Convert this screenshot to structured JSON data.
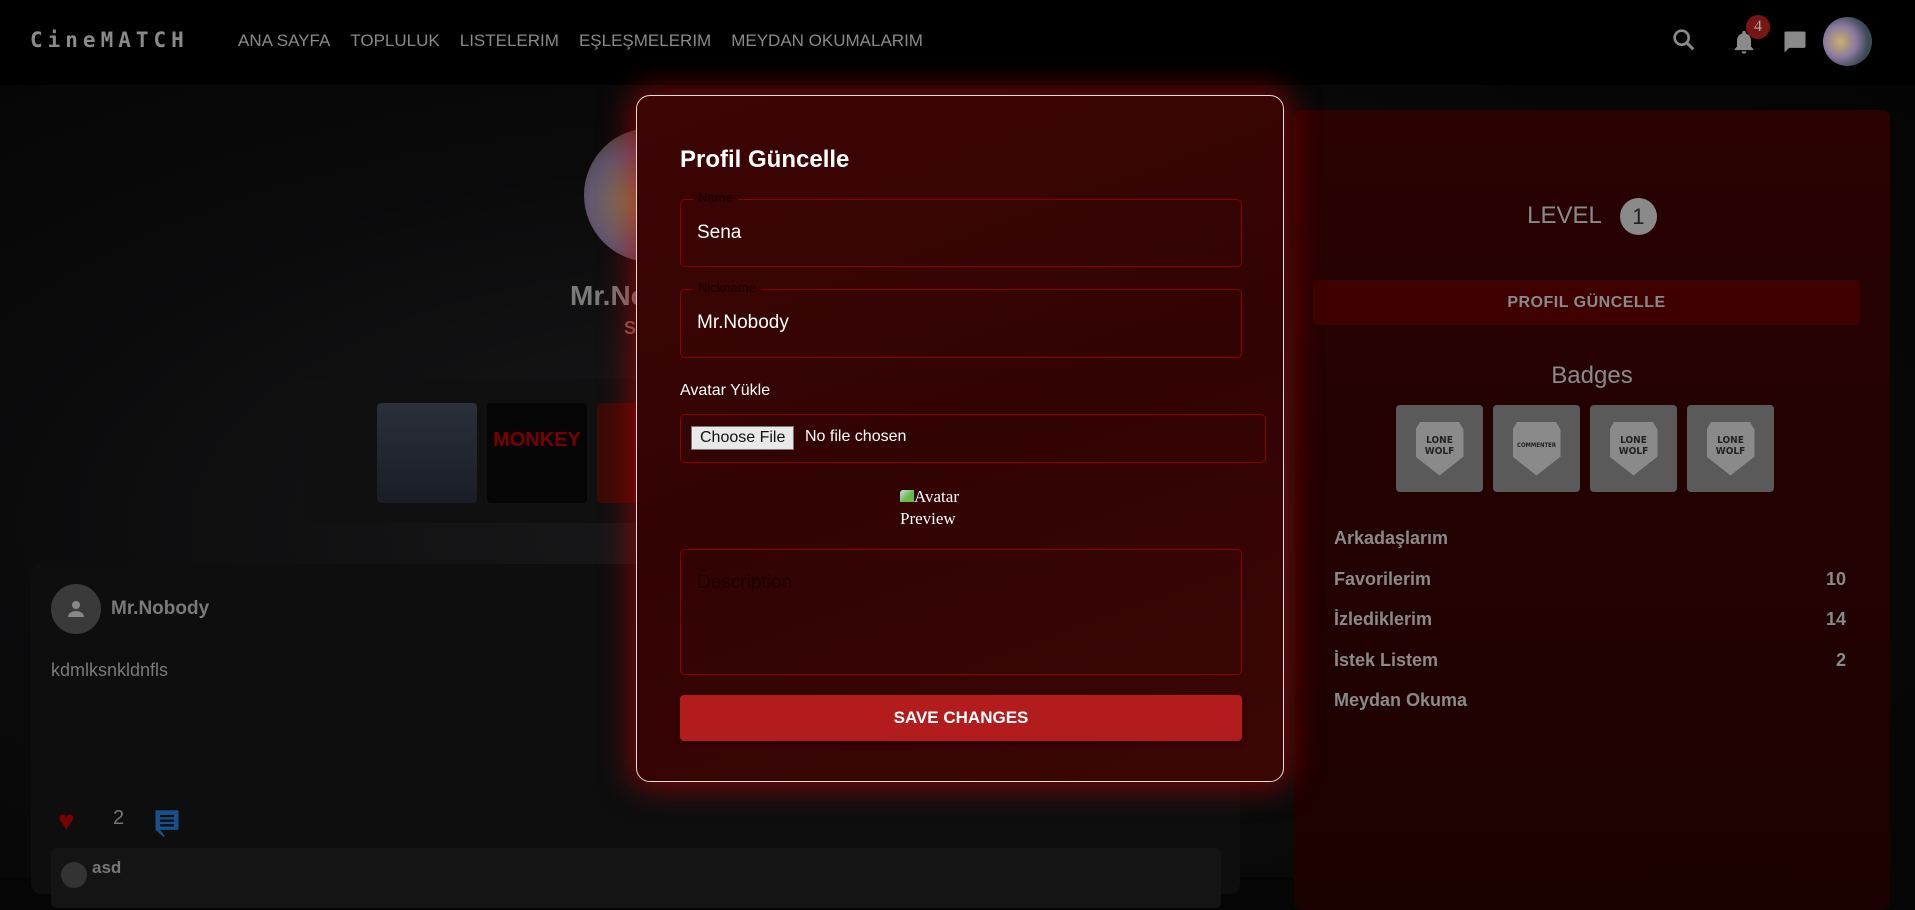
{
  "nav": {
    "logo": "CineMATCH",
    "links": [
      "ANA SAYFA",
      "TOPLULUK",
      "LISTELERIM",
      "EŞLEŞMELERIM",
      "MEYDAN OKUMALARIM"
    ],
    "notification_count": "4"
  },
  "profile": {
    "nickname": "Mr.Nobody",
    "name": "Sena"
  },
  "post": {
    "author": "Mr.Nobody",
    "text": "kdmlksnkldnfls",
    "likes": "2",
    "reply_author": "asd"
  },
  "sidebar": {
    "level_label": "LEVEL",
    "level": "1",
    "update_button": "PROFIL GÜNCELLE",
    "badges_title": "Badges",
    "badges": [
      [
        "LONE",
        "WOLF"
      ],
      [
        "COMMENTER",
        ""
      ],
      [
        "LONE",
        "WOLF"
      ],
      [
        "LONE",
        "WOLF"
      ]
    ],
    "stats": [
      {
        "label": "Arkadaşlarım",
        "value": ""
      },
      {
        "label": "Favorilerim",
        "value": "10"
      },
      {
        "label": "İzlediklerim",
        "value": "14"
      },
      {
        "label": "İstek Listem",
        "value": "2"
      },
      {
        "label": "Meydan Okuma",
        "value": ""
      }
    ]
  },
  "modal": {
    "title": "Profil Güncelle",
    "name_label": "Name",
    "name_value": "Sena",
    "nickname_label": "Nickname",
    "nickname_value": "Mr.Nobody",
    "avatar_label": "Avatar Yükle",
    "choose_file": "Choose File",
    "no_file": "No file chosen",
    "preview_alt": "Avatar Preview",
    "description_placeholder": "Description",
    "save_button": "SAVE CHANGES"
  },
  "colors": {
    "accent": "#b31c1c",
    "modal_bg": "#380404",
    "border": "#8a0000"
  }
}
